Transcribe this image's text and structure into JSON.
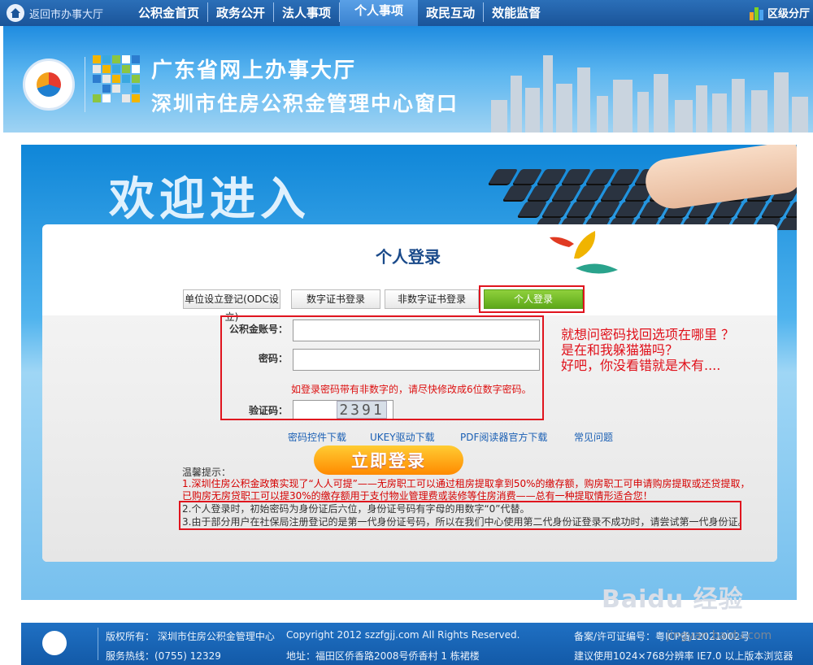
{
  "topnav": {
    "home_label": "返回市办事大厅",
    "items": [
      "公积金首页",
      "政务公开",
      "法人事项",
      "个人事项",
      "政民互动",
      "效能监督"
    ],
    "active_index": 3,
    "district_label": "区级分厅"
  },
  "banner": {
    "line1": "广东省网上办事大厅",
    "line2": "深圳市住房公积金管理中心窗口"
  },
  "welcome": {
    "text": "欢迎进入"
  },
  "login": {
    "title": "个人登录",
    "tabs": [
      "单位设立登记(ODC设立)",
      "数字证书登录",
      "非数字证书登录",
      "个人登录"
    ],
    "active_tab": 3,
    "account_label": "公积金账号：",
    "account_value": "",
    "password_label": "密码：",
    "password_value": "",
    "password_warning": "如登录密码带有非数字的，请尽快修改成6位数字密码。",
    "captcha_label": "验证码：",
    "captcha_value": "",
    "captcha_image_text": "2391",
    "links": [
      "密码控件下载",
      "UKEY驱动下载",
      "PDF阅读器官方下载",
      "常见问题"
    ],
    "submit_label": "立即登录",
    "tips_heading": "温馨提示：",
    "tip1_line1": "1.深圳住房公积金政策实现了“人人可提”——无房职工可以通过租房提取拿到50%的缴存额，购房职工可申请购房提取或还贷提取，",
    "tip1_line2": "已购房无房贷职工可以提30%的缴存额用于支付物业管理费或装修等住房消费——总有一种提取情形适合您！",
    "tip2": "2.个人登录时，初始密码为身份证后六位，身份证号码有字母的用数字“0”代替。",
    "tip3": "3.由于部分用户在社保局注册登记的是第一代身份证号码，所以在我们中心使用第二代身份证登录不成功时，请尝试第一代身份证。"
  },
  "annotation": {
    "line1": "就想问密码找回选项在哪里 ？",
    "line2": "是在和我躲猫猫吗？",
    "line3": "好吧，你没看错就是木有...."
  },
  "footer": {
    "copyright_owner": "版权所有：  深圳市住房公积金管理中心",
    "copyright": "Copyright 2012 szzfgjj.com All Rights Reserved.",
    "icp": "备案/许可证编号：粤ICP备12021002号",
    "hotline": "服务热线：(0755) 12329",
    "address": "地址：福田区侨香路2008号侨香村 1 栋裙楼",
    "browser_tip": "建议使用1024×768分辨率 IE7.0 以上版本浏览器"
  },
  "watermark": {
    "brand": "Baidu 经验",
    "url": "jingyan.baidu.com"
  },
  "colors": {
    "nav_bg": "#1a5499",
    "active_tab": "#5da81a",
    "warning_red": "#d60000",
    "link_blue": "#1a5fb4",
    "button_orange": "#ff8a00"
  }
}
